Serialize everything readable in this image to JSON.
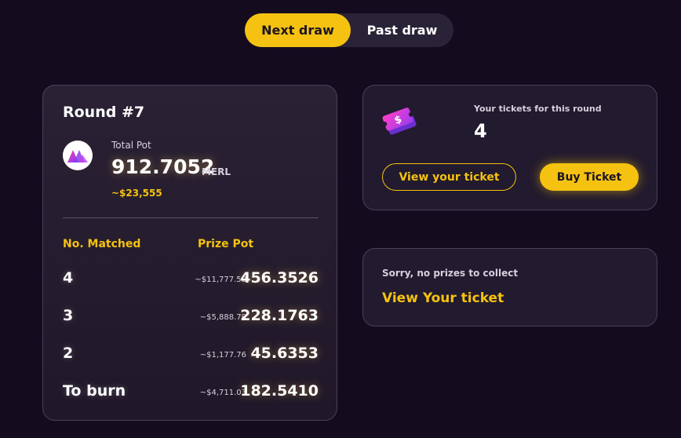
{
  "tabs": {
    "next_label": "Next draw",
    "past_label": "Past draw"
  },
  "round": {
    "title": "Round #7",
    "total_pot_label": "Total Pot",
    "total_pot_amount": "912.7052",
    "total_pot_unit": "MERL",
    "total_pot_usd": "~$23,555",
    "col_matched": "No. Matched",
    "col_prize": "Prize Pot",
    "rows": [
      {
        "label": "4",
        "usd": "~$11,777.58",
        "amount": "456.3526"
      },
      {
        "label": "3",
        "usd": "~$5,888.79",
        "amount": "228.1763"
      },
      {
        "label": "2",
        "usd": "~$1,177.76",
        "amount": "45.6353"
      },
      {
        "label": "To burn",
        "usd": "~$4,711.03",
        "amount": "182.5410"
      }
    ]
  },
  "tickets": {
    "label": "Your tickets for this round",
    "count": "4",
    "view_button": "View your ticket",
    "buy_button": "Buy Ticket",
    "icon": "ticket-icon"
  },
  "prizes": {
    "message": "Sorry, no prizes to collect",
    "link": "View Your ticket"
  },
  "colors": {
    "accent": "#f5c211",
    "background": "#150b1f",
    "card": "#221a2e",
    "border": "#4a4057"
  }
}
